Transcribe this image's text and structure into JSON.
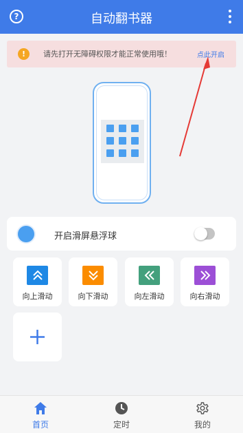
{
  "header": {
    "title": "自动翻书器",
    "help_glyph": "?",
    "help_icon": "help-circle-icon",
    "more_icon": "more-vertical-icon"
  },
  "banner": {
    "icon": "warning-icon",
    "icon_glyph": "!",
    "message": "请先打开无障碍权限才能正常使用哦！",
    "action_label": "点此开启"
  },
  "floating_ball": {
    "label": "开启滑屏悬浮球",
    "enabled": false
  },
  "actions": [
    {
      "label": "向上滑动",
      "icon": "chevrons-up-icon",
      "color": "#1e88e5"
    },
    {
      "label": "向下滑动",
      "icon": "chevrons-down-icon",
      "color": "#fb8c00"
    },
    {
      "label": "向左滑动",
      "icon": "chevrons-left-icon",
      "color": "#43a07d"
    },
    {
      "label": "向右滑动",
      "icon": "chevrons-right-icon",
      "color": "#9c4fd6"
    }
  ],
  "add_action": {
    "icon": "plus-icon",
    "color": "#3f7be8"
  },
  "tabbar": {
    "tabs": [
      {
        "label": "首页",
        "icon": "home-icon",
        "active": true
      },
      {
        "label": "定时",
        "icon": "clock-icon",
        "active": false
      },
      {
        "label": "我的",
        "icon": "gear-icon",
        "active": false
      }
    ]
  },
  "colors": {
    "primary": "#3f7be8",
    "banner_bg": "#f6dedf",
    "annotation_arrow": "#e53935"
  }
}
